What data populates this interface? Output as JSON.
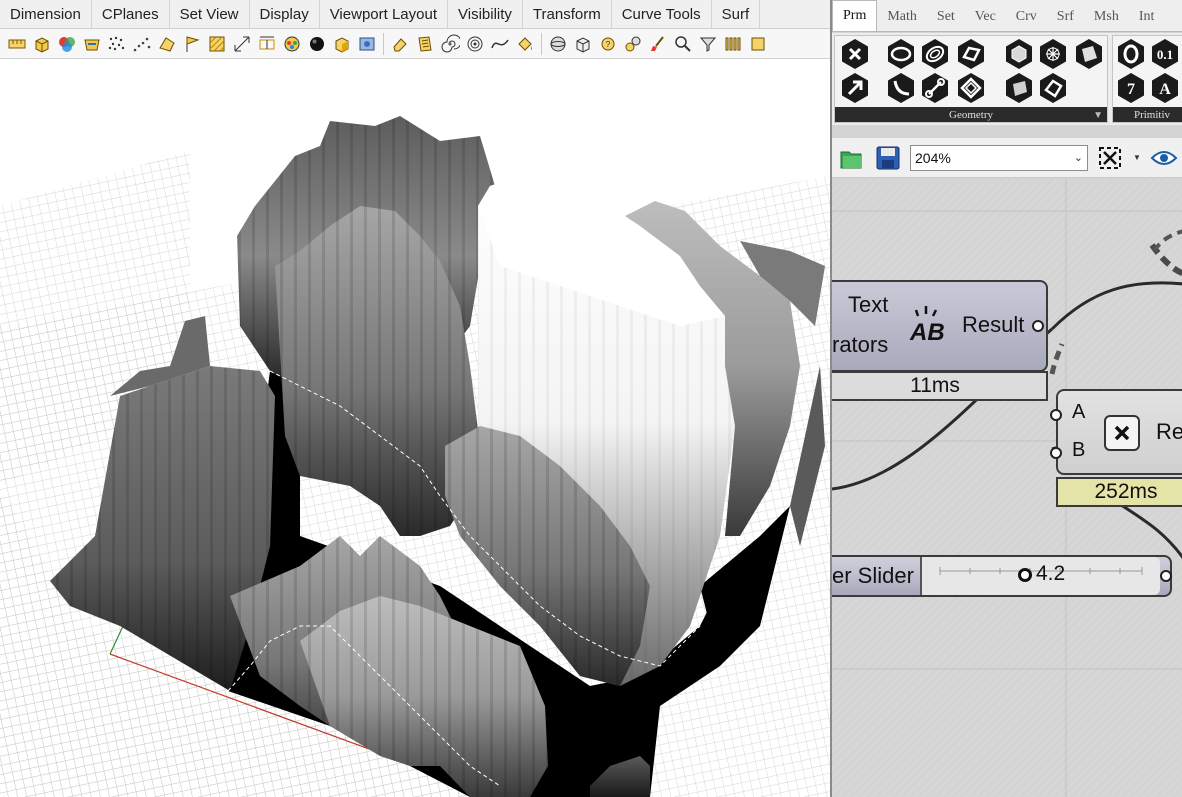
{
  "rhino": {
    "menu_tabs": [
      "Dimension",
      "CPlanes",
      "Set View",
      "Display",
      "Viewport Layout",
      "Visibility",
      "Transform",
      "Curve Tools",
      "Surf"
    ]
  },
  "grasshopper": {
    "tabs": [
      "Prm",
      "Math",
      "Set",
      "Vec",
      "Crv",
      "Srf",
      "Msh",
      "Int"
    ],
    "active_tab": "Prm",
    "ribbon": {
      "panel_geometry_label": "Geometry",
      "panel_primitive_label": "Primitiv",
      "primitive_number_label": "0.1",
      "primitive_integer_label": "7"
    },
    "canvas_bar": {
      "zoom_value": "204%"
    },
    "components": {
      "text_component": {
        "input_label_1": "Text",
        "input_label_2": "rators",
        "output_label": "Result",
        "timing": "11ms"
      },
      "operator_component": {
        "input_a": "A",
        "input_b": "B",
        "output_label": "Re",
        "timing": "252ms"
      },
      "slider": {
        "label": "er Slider",
        "value": "4.2"
      }
    }
  },
  "colors": {
    "gh_component_fill": "#b4b4c6",
    "gh_timing_light": "#dcdcdc",
    "gh_timing_yellow": "#e4e4a8",
    "gh_slider_fill": "#a9a9bd",
    "viewport_bg": "#ffffff"
  }
}
